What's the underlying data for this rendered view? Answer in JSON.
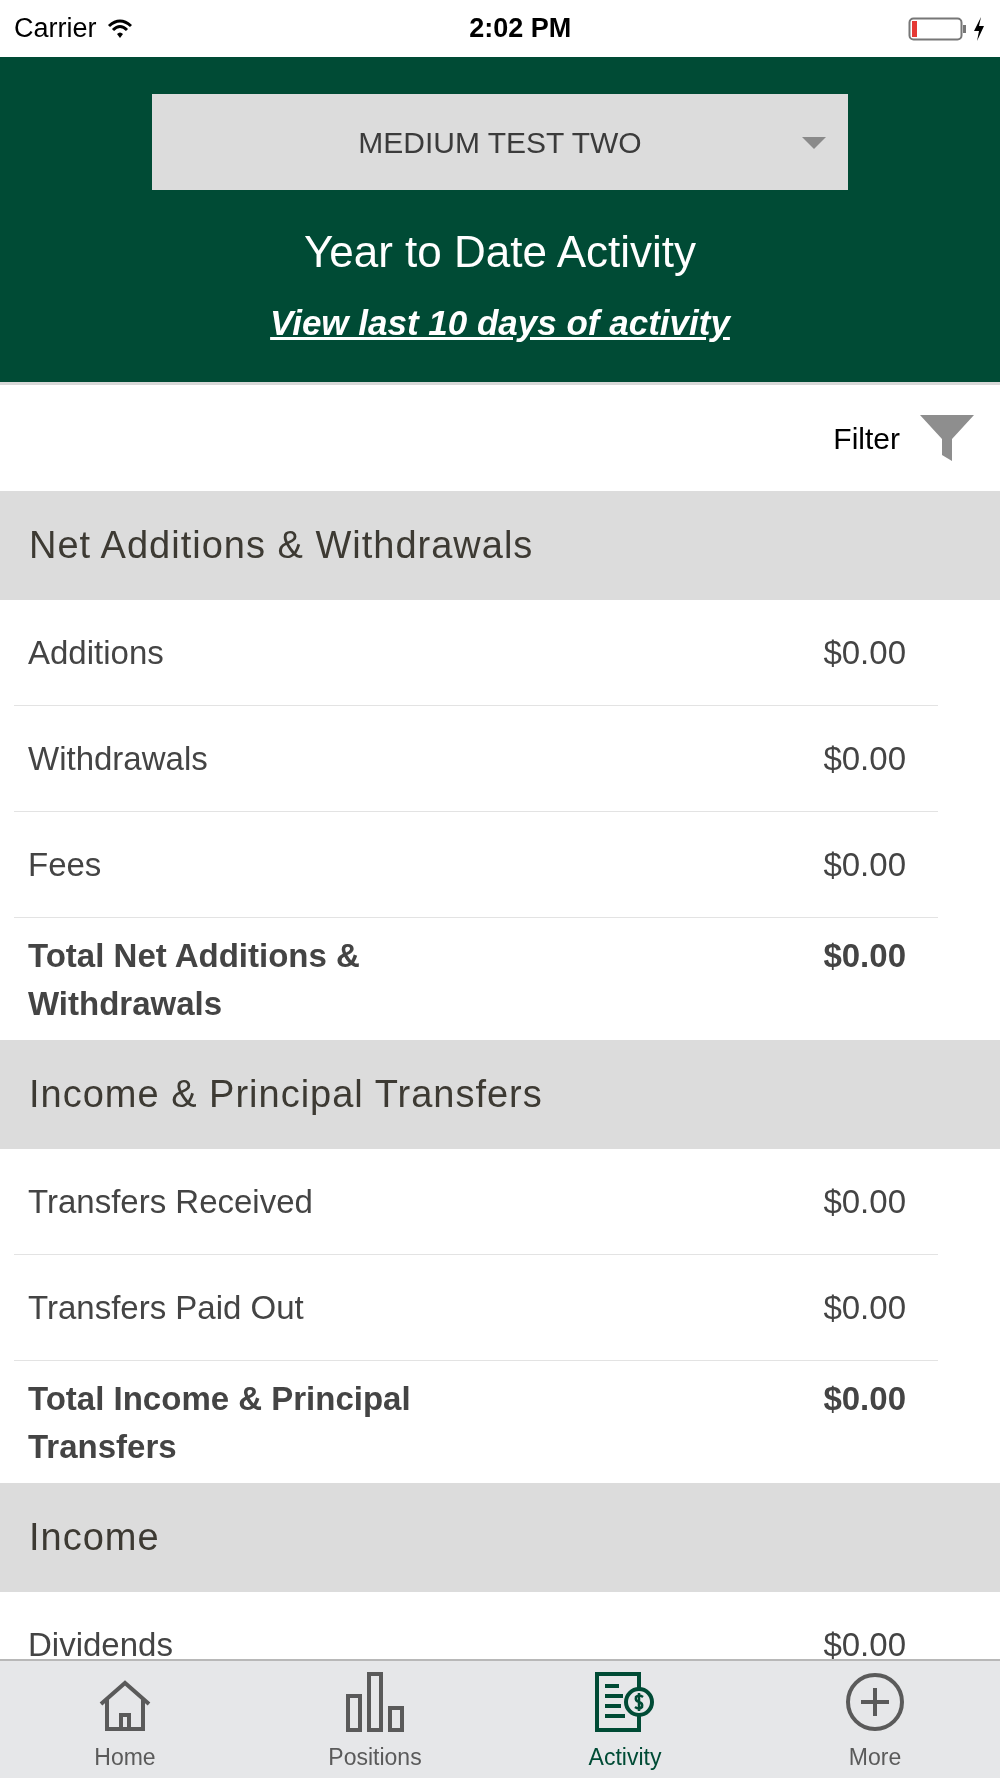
{
  "status_bar": {
    "carrier": "Carrier",
    "time": "2:02 PM"
  },
  "header": {
    "account_dropdown": "MEDIUM TEST TWO",
    "title": "Year to Date Activity",
    "link": "View last 10 days of activity"
  },
  "filter": {
    "label": "Filter"
  },
  "sections": [
    {
      "title": "Net Additions & Withdrawals",
      "rows": [
        {
          "label": "Additions",
          "amount": "$0.00",
          "kind": "item"
        },
        {
          "label": "Withdrawals",
          "amount": "$0.00",
          "kind": "item"
        },
        {
          "label": "Fees",
          "amount": "$0.00",
          "kind": "item"
        },
        {
          "label": "Total Net Additions & Withdrawals",
          "amount": "$0.00",
          "kind": "total"
        }
      ]
    },
    {
      "title": "Income & Principal Transfers",
      "rows": [
        {
          "label": "Transfers Received",
          "amount": "$0.00",
          "kind": "item"
        },
        {
          "label": "Transfers Paid Out",
          "amount": "$0.00",
          "kind": "item"
        },
        {
          "label": "Total Income & Principal Transfers",
          "amount": "$0.00",
          "kind": "total"
        }
      ]
    },
    {
      "title": "Income",
      "rows": [
        {
          "label": "Dividends",
          "amount": "$0.00",
          "kind": "item"
        }
      ]
    }
  ],
  "tab_bar": [
    {
      "label": "Home",
      "kind": "home",
      "selected": false
    },
    {
      "label": "Positions",
      "kind": "positions",
      "selected": false
    },
    {
      "label": "Activity",
      "kind": "activity",
      "selected": true
    },
    {
      "label": "More",
      "kind": "more",
      "selected": false
    }
  ]
}
